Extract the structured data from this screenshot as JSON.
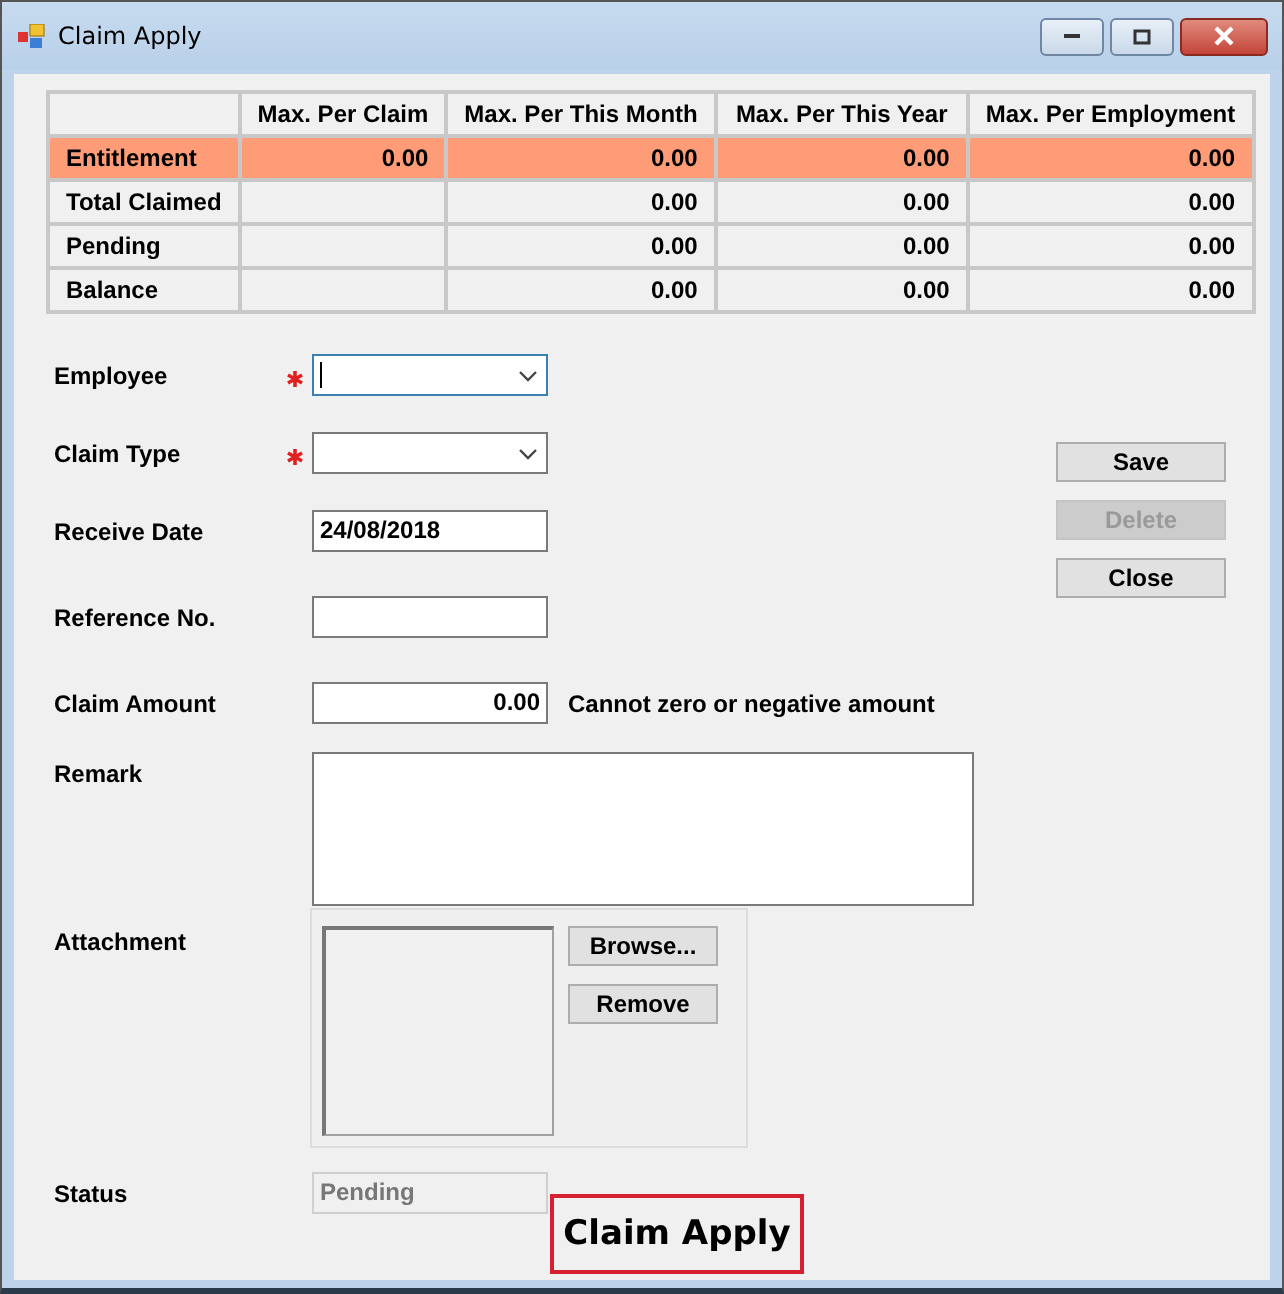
{
  "window": {
    "title": "Claim Apply"
  },
  "table": {
    "columns": [
      "Max. Per Claim",
      "Max. Per This Month",
      "Max. Per This Year",
      "Max. Per Employment"
    ],
    "rows": [
      {
        "label": "Entitlement",
        "selected": true,
        "cells": [
          "0.00",
          "0.00",
          "0.00",
          "0.00"
        ]
      },
      {
        "label": "Total Claimed",
        "selected": false,
        "cells": [
          null,
          "0.00",
          "0.00",
          "0.00"
        ]
      },
      {
        "label": "Pending",
        "selected": false,
        "cells": [
          null,
          "0.00",
          "0.00",
          "0.00"
        ]
      },
      {
        "label": "Balance",
        "selected": false,
        "cells": [
          null,
          "0.00",
          "0.00",
          "0.00"
        ]
      }
    ]
  },
  "fields": [
    {
      "kind": "combo",
      "label": "Employee",
      "required": true,
      "focused": true
    },
    {
      "kind": "combo",
      "label": "Claim Type",
      "required": true,
      "focused": false
    },
    {
      "kind": "text",
      "label": "Receive Date",
      "required": false,
      "value": "24/08/2018"
    },
    {
      "kind": "text",
      "label": "Reference No.",
      "required": false
    },
    {
      "kind": "amount",
      "label": "Claim Amount",
      "required": false,
      "value": "0.00",
      "note": "Cannot zero or negative amount"
    },
    {
      "kind": "textarea",
      "label": "Remark",
      "required": false
    },
    {
      "kind": "attachment",
      "label": "Attachment",
      "required": false,
      "buttons": [
        "Browse...",
        "Remove"
      ]
    },
    {
      "kind": "status",
      "label": "Status",
      "required": false,
      "value": "Pending",
      "disabled": true
    }
  ],
  "buttons": [
    {
      "label": "Save",
      "disabled": false
    },
    {
      "label": "Delete",
      "disabled": true
    },
    {
      "label": "Close",
      "disabled": false
    }
  ],
  "annotation": "Claim Apply"
}
